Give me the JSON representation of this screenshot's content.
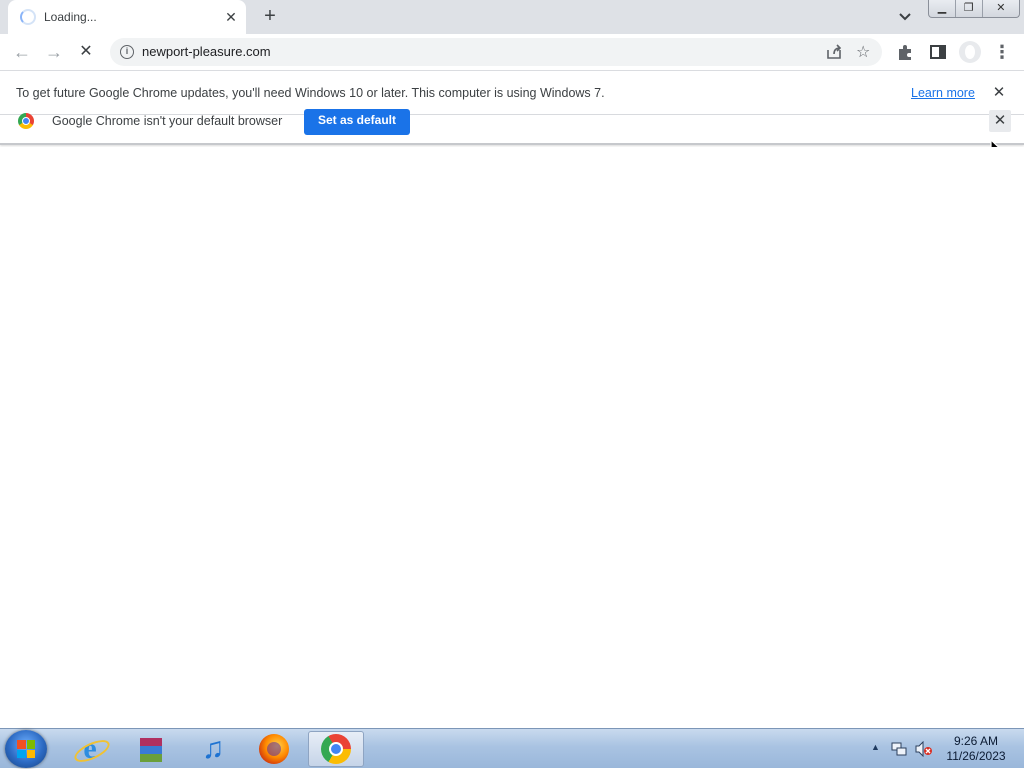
{
  "browser": {
    "tab": {
      "title": "Loading...",
      "close_label": "✕"
    },
    "new_tab_label": "+",
    "window_buttons": {
      "minimize": "▁",
      "restore": "❐",
      "close": "✕"
    },
    "toolbar": {
      "back": "←",
      "forward": "→",
      "stop": "✕",
      "url": "newport-pleasure.com",
      "info_icon": "i",
      "star": "☆",
      "menu": "⋮"
    }
  },
  "infobar_update": {
    "message": "To get future Google Chrome updates, you'll need Windows 10 or later. This computer is using Windows 7.",
    "learn_more": "Learn more",
    "close": "✕"
  },
  "infobar_default": {
    "message": "Google Chrome isn't your default browser",
    "button": "Set as default",
    "close": "✕"
  },
  "taskbar": {
    "apps": [
      "internet-explorer",
      "winrar",
      "itunes",
      "firefox",
      "chrome"
    ],
    "active_app": "chrome",
    "tray": {
      "time": "9:26 AM",
      "date": "11/26/2023",
      "expand": "▲"
    }
  },
  "colors": {
    "tabstrip": "#dee1e6",
    "accent_blue": "#1a73e8",
    "taskbar": "#a9c3e2"
  }
}
